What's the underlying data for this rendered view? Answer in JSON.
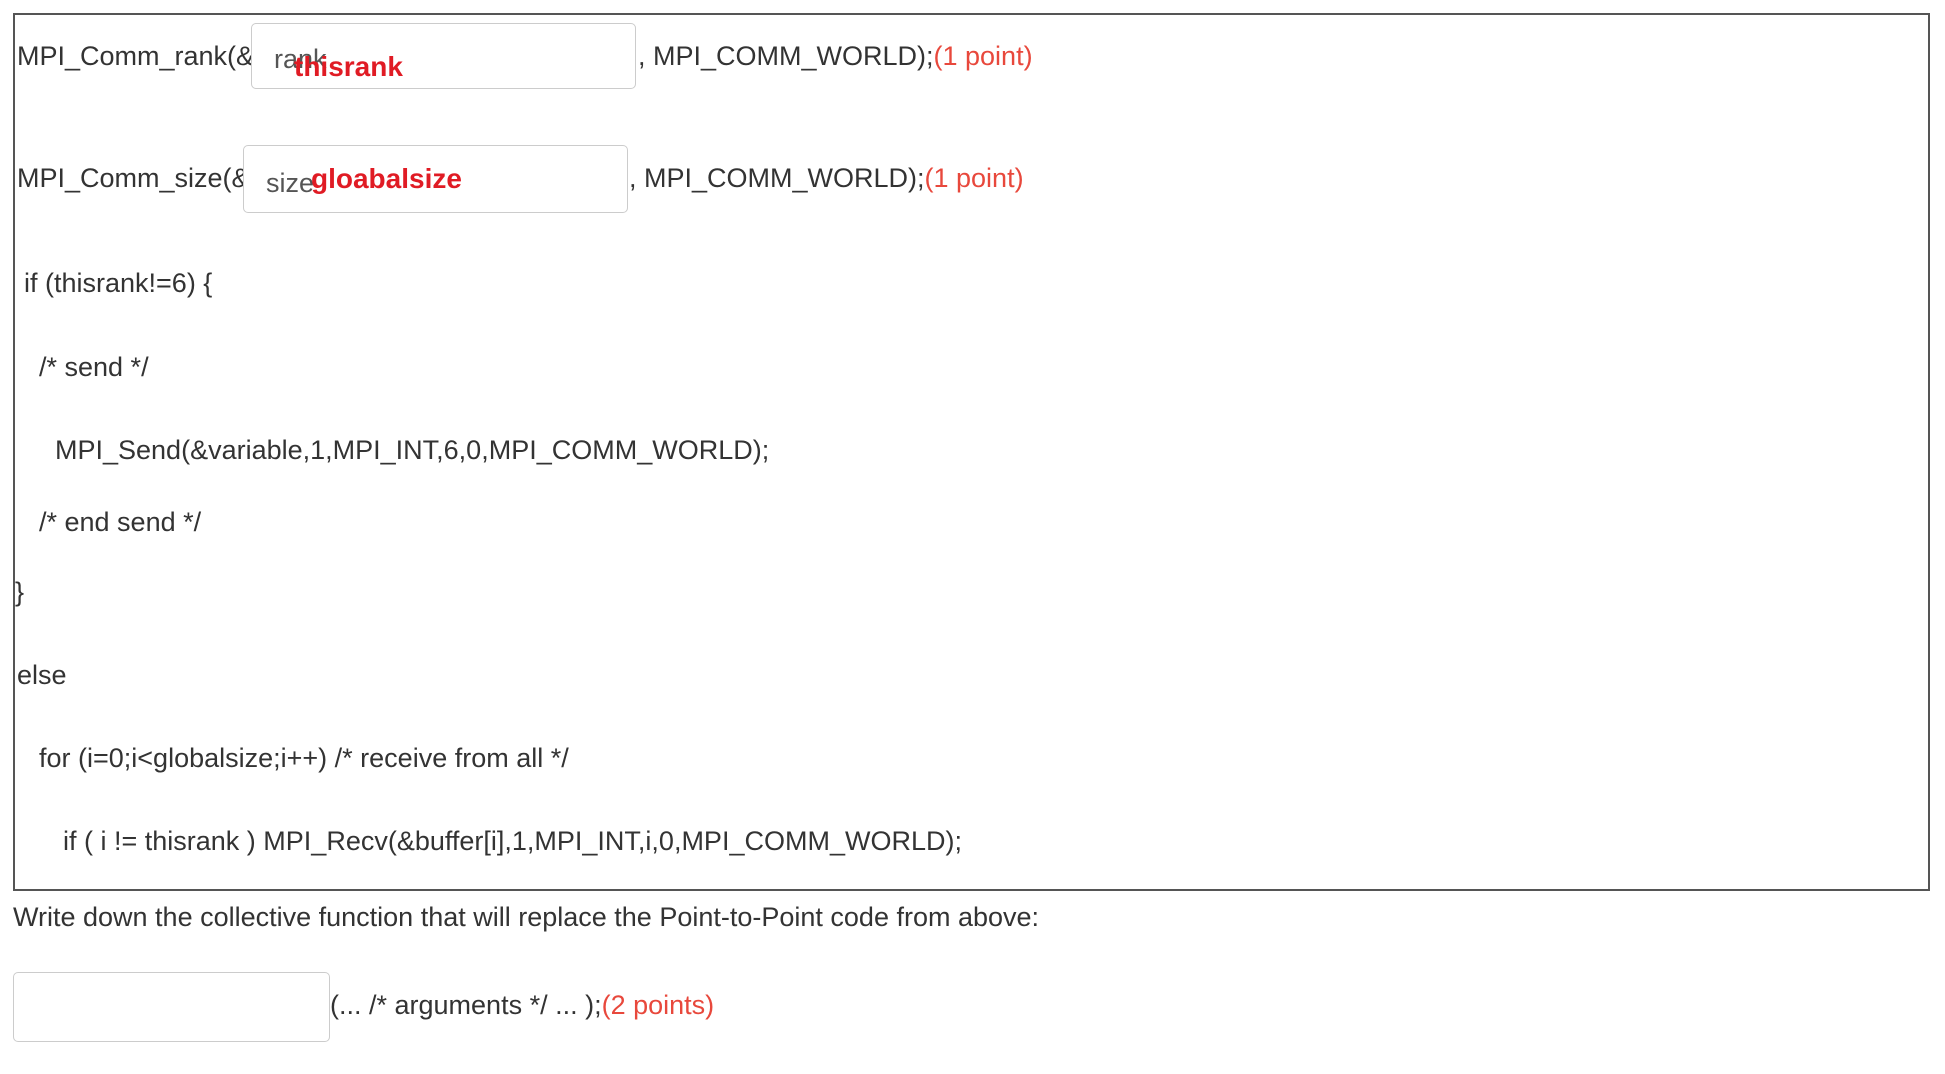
{
  "question": {
    "rank_line": {
      "prefix": "MPI_Comm_rank(&",
      "placeholder": "rank",
      "handwritten_answer": "thisrank",
      "suffix": ", MPI_COMM_WORLD);",
      "points": "(1 point)"
    },
    "size_line": {
      "prefix": "MPI_Comm_size(&",
      "placeholder": "size",
      "handwritten_answer": "gloabalsize",
      "suffix": ", MPI_COMM_WORLD);",
      "points": "(1 point)"
    },
    "code_lines": [
      "if (thisrank!=6) {",
      "/* send */",
      "MPI_Send(&variable,1,MPI_INT,6,0,MPI_COMM_WORLD);",
      "/* end send */",
      "}",
      "else",
      "for (i=0;i<globalsize;i++) /* receive from all */",
      "if ( i != thisrank ) MPI_Recv(&buffer[i],1,MPI_INT,i,0,MPI_COMM_WORLD);"
    ],
    "prompt": "Write down the collective function that will replace the Point-to-Point code from above:",
    "collective_line": {
      "input_value": "",
      "suffix": "(... /* arguments */ ... );",
      "points": "(2 points)"
    }
  },
  "colors": {
    "points_red": "#e8483c",
    "answer_red": "#e01b24",
    "border": "#555555"
  }
}
